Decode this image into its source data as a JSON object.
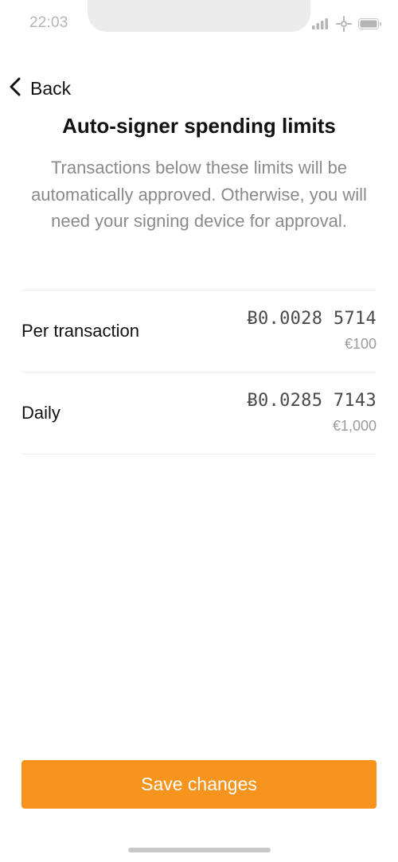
{
  "status_bar": {
    "time": "22:03",
    "icons": [
      "signal-icon",
      "wifi-icon",
      "battery-icon"
    ]
  },
  "header": {
    "back_label": "Back",
    "title": "Auto-signer spending limits",
    "description": "Transactions below these limits will be automatically approved. Otherwise, you will need your signing device for approval."
  },
  "limits": [
    {
      "label": "Per transaction",
      "btc": "Ƀ0.0028 5714",
      "fiat": "€100"
    },
    {
      "label": "Daily",
      "btc": "Ƀ0.0285 7143",
      "fiat": "€1,000"
    }
  ],
  "actions": {
    "save_label": "Save changes"
  },
  "colors": {
    "accent": "#f7941d",
    "text_primary": "#111111",
    "text_secondary": "#8a8a8a",
    "divider": "#ececec"
  }
}
